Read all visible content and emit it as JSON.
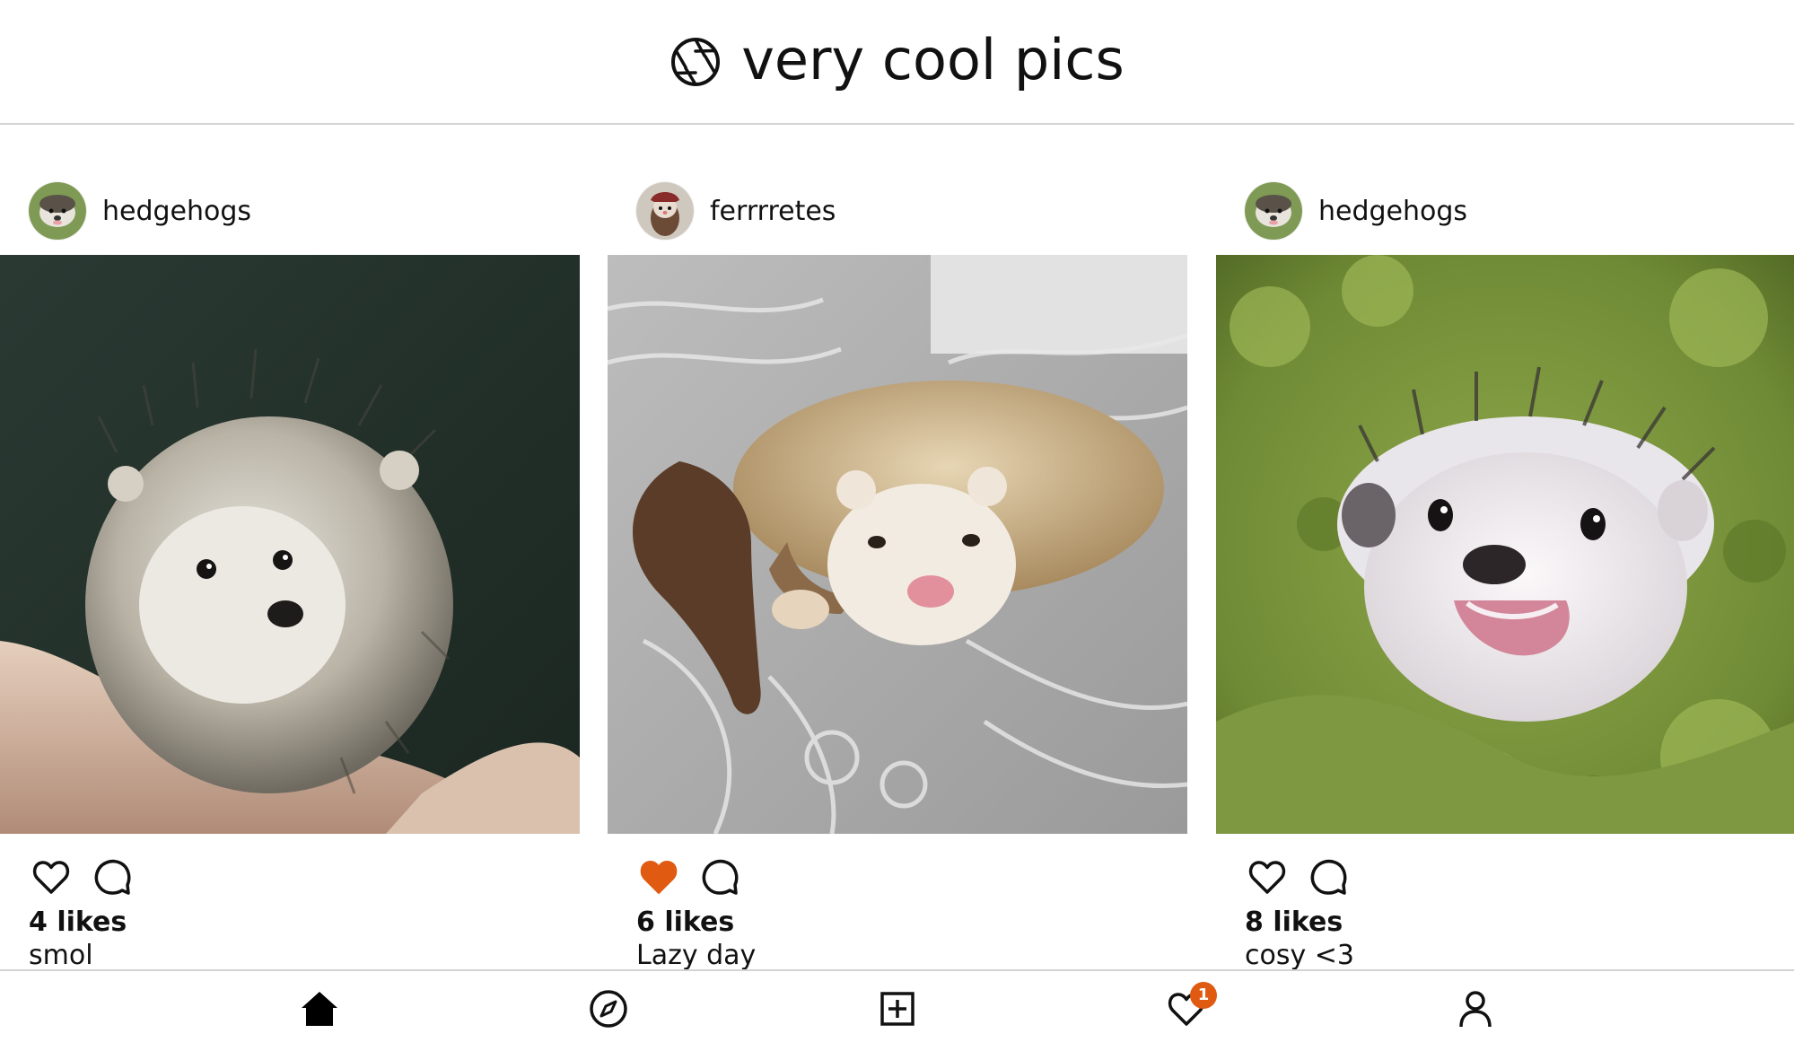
{
  "app": {
    "title": "very cool pics",
    "accent_color": "#e05a12",
    "icon": "camera-aperture-icon"
  },
  "posts": [
    {
      "username": "hedgehogs",
      "avatar_icon": "hedgehog-avatar",
      "photo_subject": "hedgehog in hand",
      "liked": false,
      "likes_text": "4 likes",
      "caption": "smol"
    },
    {
      "username": "ferrrretes",
      "avatar_icon": "ferret-avatar",
      "photo_subject": "ferret on bed",
      "liked": true,
      "likes_text": "6 likes",
      "caption": "Lazy day"
    },
    {
      "username": "hedgehogs",
      "avatar_icon": "hedgehog-avatar",
      "photo_subject": "hedgehog in green blanket",
      "liked": false,
      "likes_text": "8 likes",
      "caption": "cosy <3"
    }
  ],
  "bottom_nav": {
    "items": [
      {
        "icon": "home-icon"
      },
      {
        "icon": "explore-compass-icon"
      },
      {
        "icon": "add-post-icon"
      },
      {
        "icon": "activity-heart-icon",
        "badge": "1"
      },
      {
        "icon": "profile-icon"
      }
    ],
    "badge_color": "#e05a12"
  }
}
